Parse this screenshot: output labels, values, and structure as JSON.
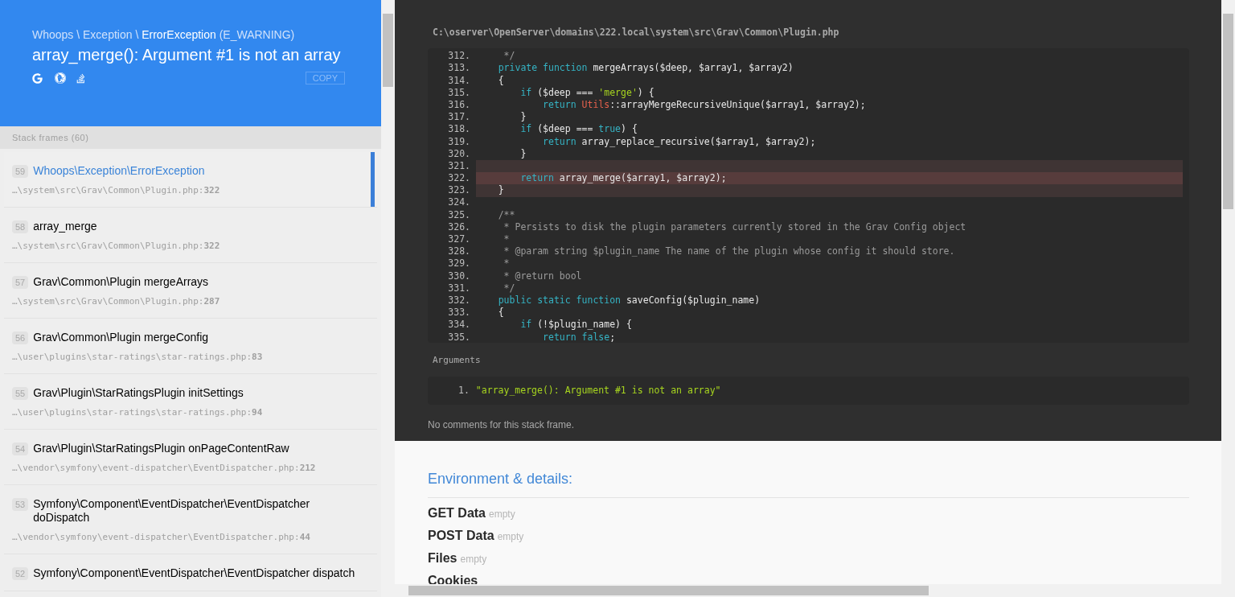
{
  "header": {
    "exception_line": [
      {
        "kind": "namespace",
        "text": "Whoops \\ Exception \\ "
      },
      {
        "kind": "class",
        "text": "ErrorException"
      },
      {
        "kind": "code",
        "text": " (E_WARNING)"
      }
    ],
    "message": "array_merge(): Argument #1 is not an array",
    "copy_button": "COPY"
  },
  "stack_frames_label": "Stack frames (60)",
  "frames": [
    {
      "index": "59",
      "title": "Whoops\\Exception\\ErrorException",
      "path": "…\\system\\src\\Grav\\Common\\Plugin.php:",
      "line": "322",
      "selected": true
    },
    {
      "index": "58",
      "title": "array_merge",
      "path": "…\\system\\src\\Grav\\Common\\Plugin.php:",
      "line": "322",
      "selected": false
    },
    {
      "index": "57",
      "title": "Grav\\Common\\Plugin mergeArrays",
      "path": "…\\system\\src\\Grav\\Common\\Plugin.php:",
      "line": "287",
      "selected": false
    },
    {
      "index": "56",
      "title": "Grav\\Common\\Plugin mergeConfig",
      "path": "…\\user\\plugins\\star-ratings\\star-ratings.php:",
      "line": "83",
      "selected": false
    },
    {
      "index": "55",
      "title": "Grav\\Plugin\\StarRatingsPlugin initSettings",
      "path": "…\\user\\plugins\\star-ratings\\star-ratings.php:",
      "line": "94",
      "selected": false
    },
    {
      "index": "54",
      "title": "Grav\\Plugin\\StarRatingsPlugin onPageContentRaw",
      "path": "…\\vendor\\symfony\\event-dispatcher\\EventDispatcher.php:",
      "line": "212",
      "selected": false
    },
    {
      "index": "53",
      "title": "Symfony\\Component\\EventDispatcher\\EventDispatcher doDispatch",
      "path": "…\\vendor\\symfony\\event-dispatcher\\EventDispatcher.php:",
      "line": "44",
      "selected": false
    },
    {
      "index": "52",
      "title": "Symfony\\Component\\EventDispatcher\\EventDispatcher dispatch",
      "selected": false
    }
  ],
  "file_path": "C:\\oserver\\OpenServer\\domains\\222.local\\system\\src\\Grav\\Common\\Plugin.php",
  "code_lines": [
    {
      "number": "312.",
      "kind": "normal",
      "tokens": [
        {
          "kind": "comment",
          "text": "     */"
        }
      ]
    },
    {
      "number": "313.",
      "kind": "normal",
      "tokens": [
        {
          "kind": "keyword",
          "text": "    private function"
        },
        {
          "kind": "plain",
          "text": " mergeArrays($deep, $array1, $array2)"
        }
      ]
    },
    {
      "number": "314.",
      "kind": "normal",
      "tokens": [
        {
          "kind": "plain",
          "text": "    {"
        }
      ]
    },
    {
      "number": "315.",
      "kind": "normal",
      "tokens": [
        {
          "kind": "keyword",
          "text": "        if"
        },
        {
          "kind": "plain",
          "text": " ($deep === "
        },
        {
          "kind": "string",
          "text": "'merge'"
        },
        {
          "kind": "plain",
          "text": ") {"
        }
      ]
    },
    {
      "number": "316.",
      "kind": "normal",
      "tokens": [
        {
          "kind": "keyword",
          "text": "            return"
        },
        {
          "kind": "class",
          "text": " Utils"
        },
        {
          "kind": "plain",
          "text": "::arrayMergeRecursiveUnique($array1, $array2);"
        }
      ]
    },
    {
      "number": "317.",
      "kind": "normal",
      "tokens": [
        {
          "kind": "plain",
          "text": "        }"
        }
      ]
    },
    {
      "number": "318.",
      "kind": "normal",
      "tokens": [
        {
          "kind": "keyword",
          "text": "        if"
        },
        {
          "kind": "plain",
          "text": " ($deep === "
        },
        {
          "kind": "keyword",
          "text": "true"
        },
        {
          "kind": "plain",
          "text": ") {"
        }
      ]
    },
    {
      "number": "319.",
      "kind": "normal",
      "tokens": [
        {
          "kind": "keyword",
          "text": "            return"
        },
        {
          "kind": "plain",
          "text": " array_replace_recursive($array1, $array2);"
        }
      ]
    },
    {
      "number": "320.",
      "kind": "normal",
      "tokens": [
        {
          "kind": "plain",
          "text": "        }"
        }
      ]
    },
    {
      "number": "321.",
      "kind": "context"
    },
    {
      "number": "322.",
      "kind": "error",
      "tokens": [
        {
          "kind": "keyword",
          "text": "        return"
        },
        {
          "kind": "plain",
          "text": " array_merge($array1, $array2);"
        }
      ]
    },
    {
      "number": "323.",
      "kind": "context",
      "tokens": [
        {
          "kind": "plain",
          "text": "    }"
        }
      ]
    },
    {
      "number": "324.",
      "kind": "normal"
    },
    {
      "number": "325.",
      "kind": "normal",
      "tokens": [
        {
          "kind": "comment",
          "text": "    /**"
        }
      ]
    },
    {
      "number": "326.",
      "kind": "normal",
      "tokens": [
        {
          "kind": "comment",
          "text": "     * Persists to disk the plugin parameters currently stored in the Grav Config object"
        }
      ]
    },
    {
      "number": "327.",
      "kind": "normal",
      "tokens": [
        {
          "kind": "comment",
          "text": "     *"
        }
      ]
    },
    {
      "number": "328.",
      "kind": "normal",
      "tokens": [
        {
          "kind": "comment",
          "text": "     * @param string $plugin_name The name of the plugin whose config it should store."
        }
      ]
    },
    {
      "number": "329.",
      "kind": "normal",
      "tokens": [
        {
          "kind": "comment",
          "text": "     *"
        }
      ]
    },
    {
      "number": "330.",
      "kind": "normal",
      "tokens": [
        {
          "kind": "comment",
          "text": "     * @return bool"
        }
      ]
    },
    {
      "number": "331.",
      "kind": "normal",
      "tokens": [
        {
          "kind": "comment",
          "text": "     */"
        }
      ]
    },
    {
      "number": "332.",
      "kind": "normal",
      "tokens": [
        {
          "kind": "keyword",
          "text": "    public static function"
        },
        {
          "kind": "plain",
          "text": " saveConfig($plugin_name)"
        }
      ]
    },
    {
      "number": "333.",
      "kind": "normal",
      "tokens": [
        {
          "kind": "plain",
          "text": "    {"
        }
      ]
    },
    {
      "number": "334.",
      "kind": "normal",
      "tokens": [
        {
          "kind": "keyword",
          "text": "        if"
        },
        {
          "kind": "plain",
          "text": " (!$plugin_name) {"
        }
      ]
    },
    {
      "number": "335.",
      "kind": "normal",
      "tokens": [
        {
          "kind": "keyword",
          "text": "            return false"
        },
        {
          "kind": "plain",
          "text": ";"
        }
      ]
    }
  ],
  "arguments_label": "Arguments",
  "arguments": [
    {
      "number": "1.",
      "value": "\"array_merge(): Argument #1 is not an array\""
    }
  ],
  "comments_note": "No comments for this stack frame.",
  "environment": {
    "title": "Environment & details:",
    "sections": [
      {
        "name": "GET Data",
        "note": "empty"
      },
      {
        "name": "POST Data",
        "note": "empty"
      },
      {
        "name": "Files",
        "note": "empty"
      },
      {
        "name": "Cookies"
      }
    ]
  }
}
